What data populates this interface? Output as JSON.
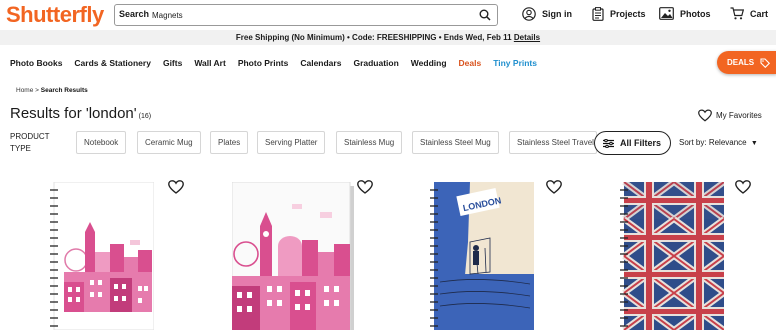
{
  "header": {
    "logo": "Shutterfly",
    "search_label": "Search",
    "search_value": "Magnets",
    "signin": "Sign in",
    "projects": "Projects",
    "photos": "Photos",
    "cart": "Cart"
  },
  "promo": {
    "text": "Free Shipping (No Minimum) • Code: FREESHIPPING • Ends Wed, Feb 11",
    "details": "Details"
  },
  "nav": {
    "items": [
      "Photo Books",
      "Cards & Stationery",
      "Gifts",
      "Wall Art",
      "Photo Prints",
      "Calendars",
      "Graduation",
      "Wedding"
    ],
    "deals": "Deals",
    "tiny_prints": "Tiny Prints",
    "deals_button": "DEALS"
  },
  "breadcrumb": {
    "home": "Home",
    "sep": ">",
    "current": "Search Results"
  },
  "results": {
    "title": "Results for 'london'",
    "count": "(16)"
  },
  "favorites": "My Favorites",
  "filters": {
    "product_type_label": "PRODUCT TYPE",
    "chips": [
      "Notebook",
      "Ceramic Mug",
      "Plates",
      "Serving Platter",
      "Stainless Mug",
      "Stainless Steel Mug",
      "Stainless Steel Travel Mug"
    ],
    "all_filters": "All Filters",
    "sort_label": "Sort by:",
    "sort_value": "Relevance"
  },
  "products": [
    {
      "name": "london-skyline-pink-notebook"
    },
    {
      "name": "london-skyline-pink-photo-book"
    },
    {
      "name": "london-vintage-poster-notebook",
      "cover_text": "LONDON"
    },
    {
      "name": "union-jack-notebook"
    }
  ],
  "colors": {
    "brand": "#f26522",
    "deals": "#d9531e",
    "tiny_prints": "#1f8fce",
    "pink": "#d94f8f"
  }
}
